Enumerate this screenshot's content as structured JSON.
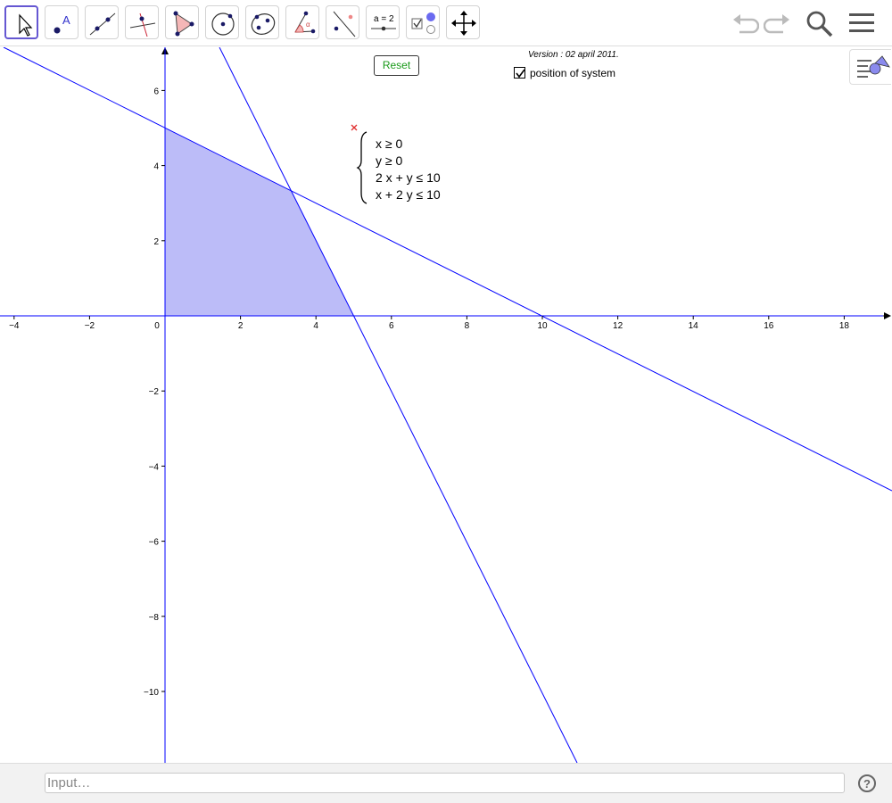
{
  "toolbar": {
    "tools": [
      {
        "name": "move-tool-icon",
        "label": "Move"
      },
      {
        "name": "point-tool-icon",
        "label": "A"
      },
      {
        "name": "line-tool-icon",
        "label": "Line"
      },
      {
        "name": "perpendicular-tool-icon",
        "label": "Perpendicular Line"
      },
      {
        "name": "polygon-tool-icon",
        "label": "Polygon"
      },
      {
        "name": "circle-tool-icon",
        "label": "Circle"
      },
      {
        "name": "conic-tool-icon",
        "label": "Ellipse"
      },
      {
        "name": "angle-tool-icon",
        "label": "Angle"
      },
      {
        "name": "reflect-tool-icon",
        "label": "Reflect"
      },
      {
        "name": "slider-tool-icon",
        "label": "a = 2"
      },
      {
        "name": "checkbox-tool-icon",
        "label": "Check Box"
      },
      {
        "name": "move-graphics-tool-icon",
        "label": "Move Graphics View"
      }
    ],
    "slider_label": "a = 2",
    "point_label": "A"
  },
  "canvas": {
    "reset_label": "Reset",
    "version_text": "Version : 02 april 2011.",
    "checkbox_label": "position of system",
    "checkbox_checked": true,
    "inequalities": [
      "x ≥ 0",
      "y ≥ 0",
      "2 x + y ≤ 10",
      "x + 2 y ≤ 10"
    ],
    "x_ticks": [
      "−4",
      "−2",
      "0",
      "2",
      "4",
      "6",
      "8",
      "10",
      "12",
      "14",
      "16",
      "18"
    ],
    "y_ticks_pos": [
      "2",
      "4",
      "6"
    ],
    "y_ticks_neg": [
      "−2",
      "−4",
      "−6",
      "−8",
      "−10"
    ],
    "line_color": "#0000ff",
    "region_color": "#bcbcf8"
  },
  "footer": {
    "input_placeholder": "Input…",
    "help_label": "?"
  }
}
